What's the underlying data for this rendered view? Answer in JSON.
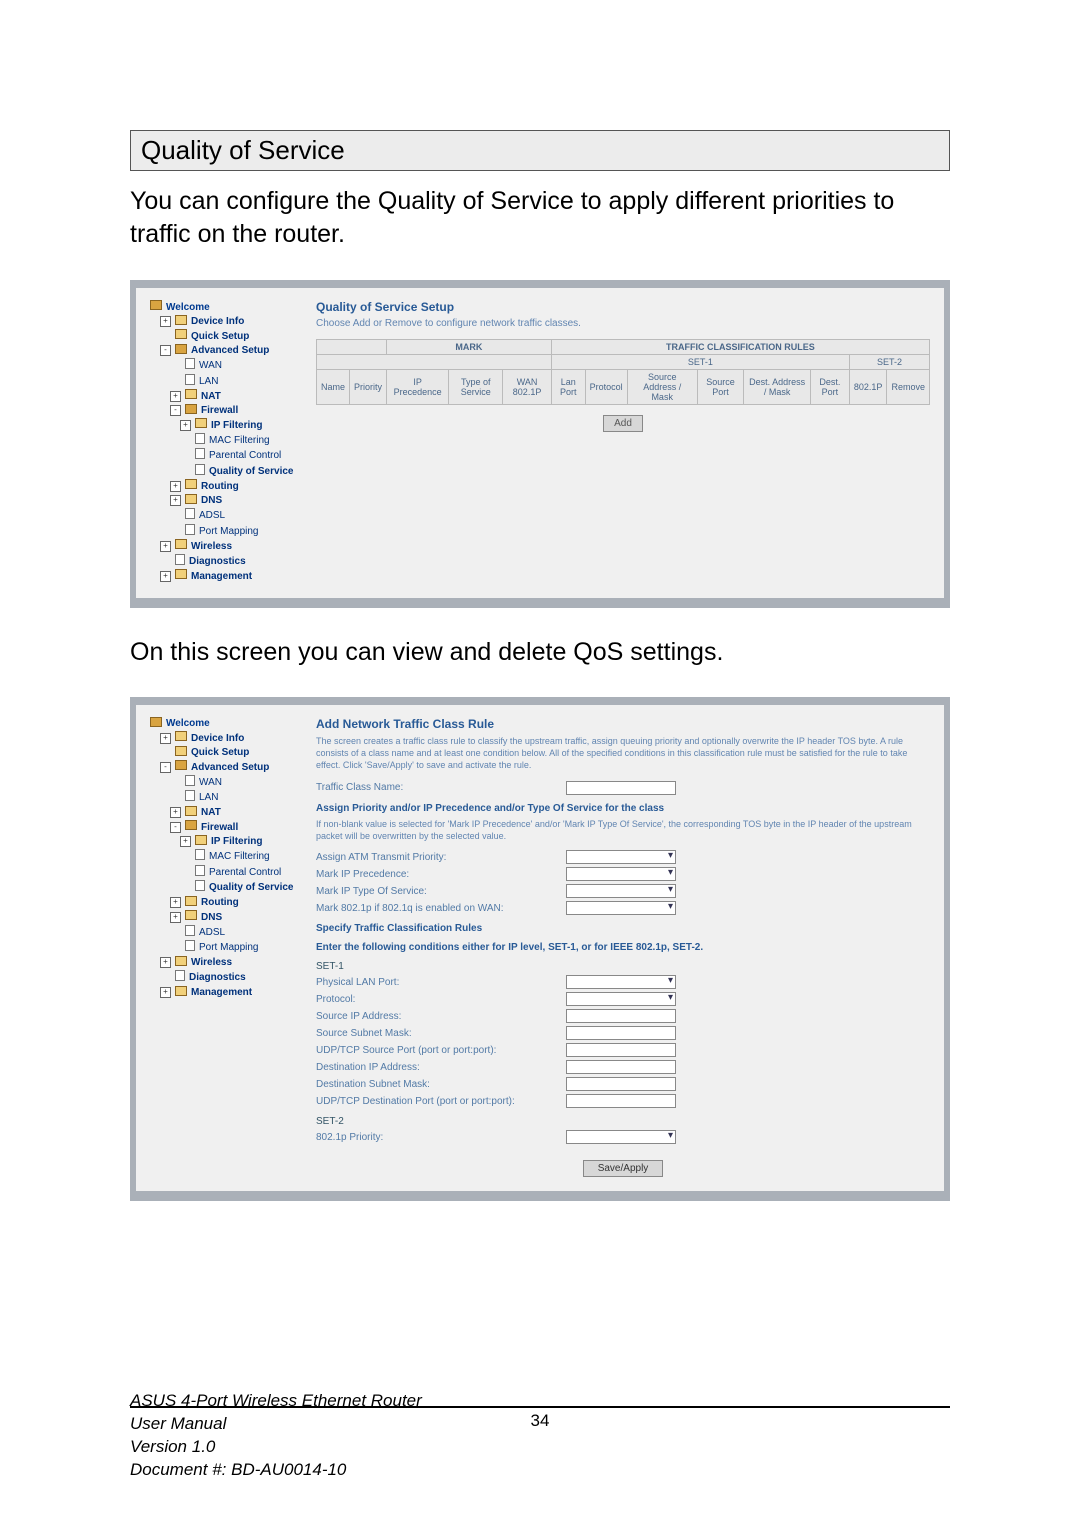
{
  "heading": "Quality of Service",
  "intro": "You can configure the Quality of Service to apply different priorities to traffic on the router.",
  "mid_text": "On this screen you can view and delete QoS settings.",
  "nav": {
    "welcome": "Welcome",
    "items": [
      {
        "level": 1,
        "icon": "folder-closed",
        "expand": "+",
        "label": "Device Info",
        "bold": true
      },
      {
        "level": 1,
        "icon": "folder-closed",
        "expand": "",
        "label": "Quick Setup",
        "bold": true
      },
      {
        "level": 1,
        "icon": "folder-open",
        "expand": "-",
        "label": "Advanced Setup",
        "bold": true
      },
      {
        "level": 2,
        "icon": "page-ic",
        "expand": "",
        "label": "WAN"
      },
      {
        "level": 2,
        "icon": "page-ic",
        "expand": "",
        "label": "LAN"
      },
      {
        "level": 2,
        "icon": "folder-closed",
        "expand": "+",
        "label": "NAT",
        "bold": true
      },
      {
        "level": 2,
        "icon": "folder-open",
        "expand": "-",
        "label": "Firewall",
        "bold": true
      },
      {
        "level": 3,
        "icon": "folder-closed",
        "expand": "+",
        "label": "IP Filtering",
        "bold": true
      },
      {
        "level": 3,
        "icon": "page-ic",
        "expand": "",
        "label": "MAC Filtering"
      },
      {
        "level": 3,
        "icon": "page-ic",
        "expand": "",
        "label": "Parental Control"
      },
      {
        "level": 3,
        "icon": "page-ic",
        "expand": "",
        "label": "Quality of Service",
        "bold": true
      },
      {
        "level": 2,
        "icon": "folder-closed",
        "expand": "+",
        "label": "Routing",
        "bold": true
      },
      {
        "level": 2,
        "icon": "folder-closed",
        "expand": "+",
        "label": "DNS",
        "bold": true
      },
      {
        "level": 2,
        "icon": "page-ic",
        "expand": "",
        "label": "ADSL"
      },
      {
        "level": 2,
        "icon": "page-ic",
        "expand": "",
        "label": "Port Mapping"
      },
      {
        "level": 1,
        "icon": "folder-closed",
        "expand": "+",
        "label": "Wireless",
        "bold": true
      },
      {
        "level": 1,
        "icon": "page-ic",
        "expand": "",
        "label": "Diagnostics",
        "bold": true
      },
      {
        "level": 1,
        "icon": "folder-closed",
        "expand": "+",
        "label": "Management",
        "bold": true
      }
    ]
  },
  "qos_setup": {
    "title": "Quality of Service Setup",
    "desc": "Choose Add or Remove to configure network traffic classes.",
    "group_mark": "MARK",
    "group_rules": "TRAFFIC CLASSIFICATION RULES",
    "sub_set1": "SET-1",
    "sub_set2": "SET-2",
    "cols": [
      "Name",
      "Priority",
      "IP Precedence",
      "Type of Service",
      "WAN 802.1P",
      "Lan Port",
      "Protocol",
      "Source Address / Mask",
      "Source Port",
      "Dest. Address / Mask",
      "Dest. Port",
      "802.1P",
      "Remove"
    ],
    "add_btn": "Add"
  },
  "add_rule": {
    "title": "Add Network Traffic Class Rule",
    "desc": "The screen creates a traffic class rule to classify the upstream traffic, assign queuing priority and optionally overwrite the IP header TOS byte. A rule consists of a class name and at least one condition below. All of the specified conditions in this classification rule must be satisfied for the rule to take effect. Click 'Save/Apply' to save and activate the rule.",
    "traffic_name": "Traffic Class Name:",
    "assign_heading": "Assign Priority and/or IP Precedence and/or Type Of Service for the class",
    "assign_note": "If non-blank value is selected for 'Mark IP Precedence' and/or 'Mark IP Type Of Service', the corresponding TOS byte in the IP header of the upstream packet will be overwritten by the selected value.",
    "fields_mark": [
      "Assign ATM Transmit Priority:",
      "Mark IP Precedence:",
      "Mark IP Type Of Service:",
      "Mark 802.1p if 802.1q is enabled on WAN:"
    ],
    "specify_heading": "Specify Traffic Classification Rules",
    "enter_line": "Enter the following conditions either for IP level, SET-1, or for IEEE 802.1p, SET-2.",
    "set1_label": "SET-1",
    "set1_fields": [
      "Physical LAN Port:",
      "Protocol:",
      "Source IP Address:",
      "Source Subnet Mask:",
      "UDP/TCP Source Port (port or port:port):",
      "Destination IP Address:",
      "Destination Subnet Mask:",
      "UDP/TCP Destination Port (port or port:port):"
    ],
    "set2_label": "SET-2",
    "set2_field": "802.1p Priority:",
    "save_btn": "Save/Apply"
  },
  "footer": {
    "l1": "ASUS 4-Port Wireless Ethernet Router",
    "l2": "User Manual",
    "l3": "Version 1.0",
    "l4": "Document #:  BD-AU0014-10",
    "page": "34"
  }
}
